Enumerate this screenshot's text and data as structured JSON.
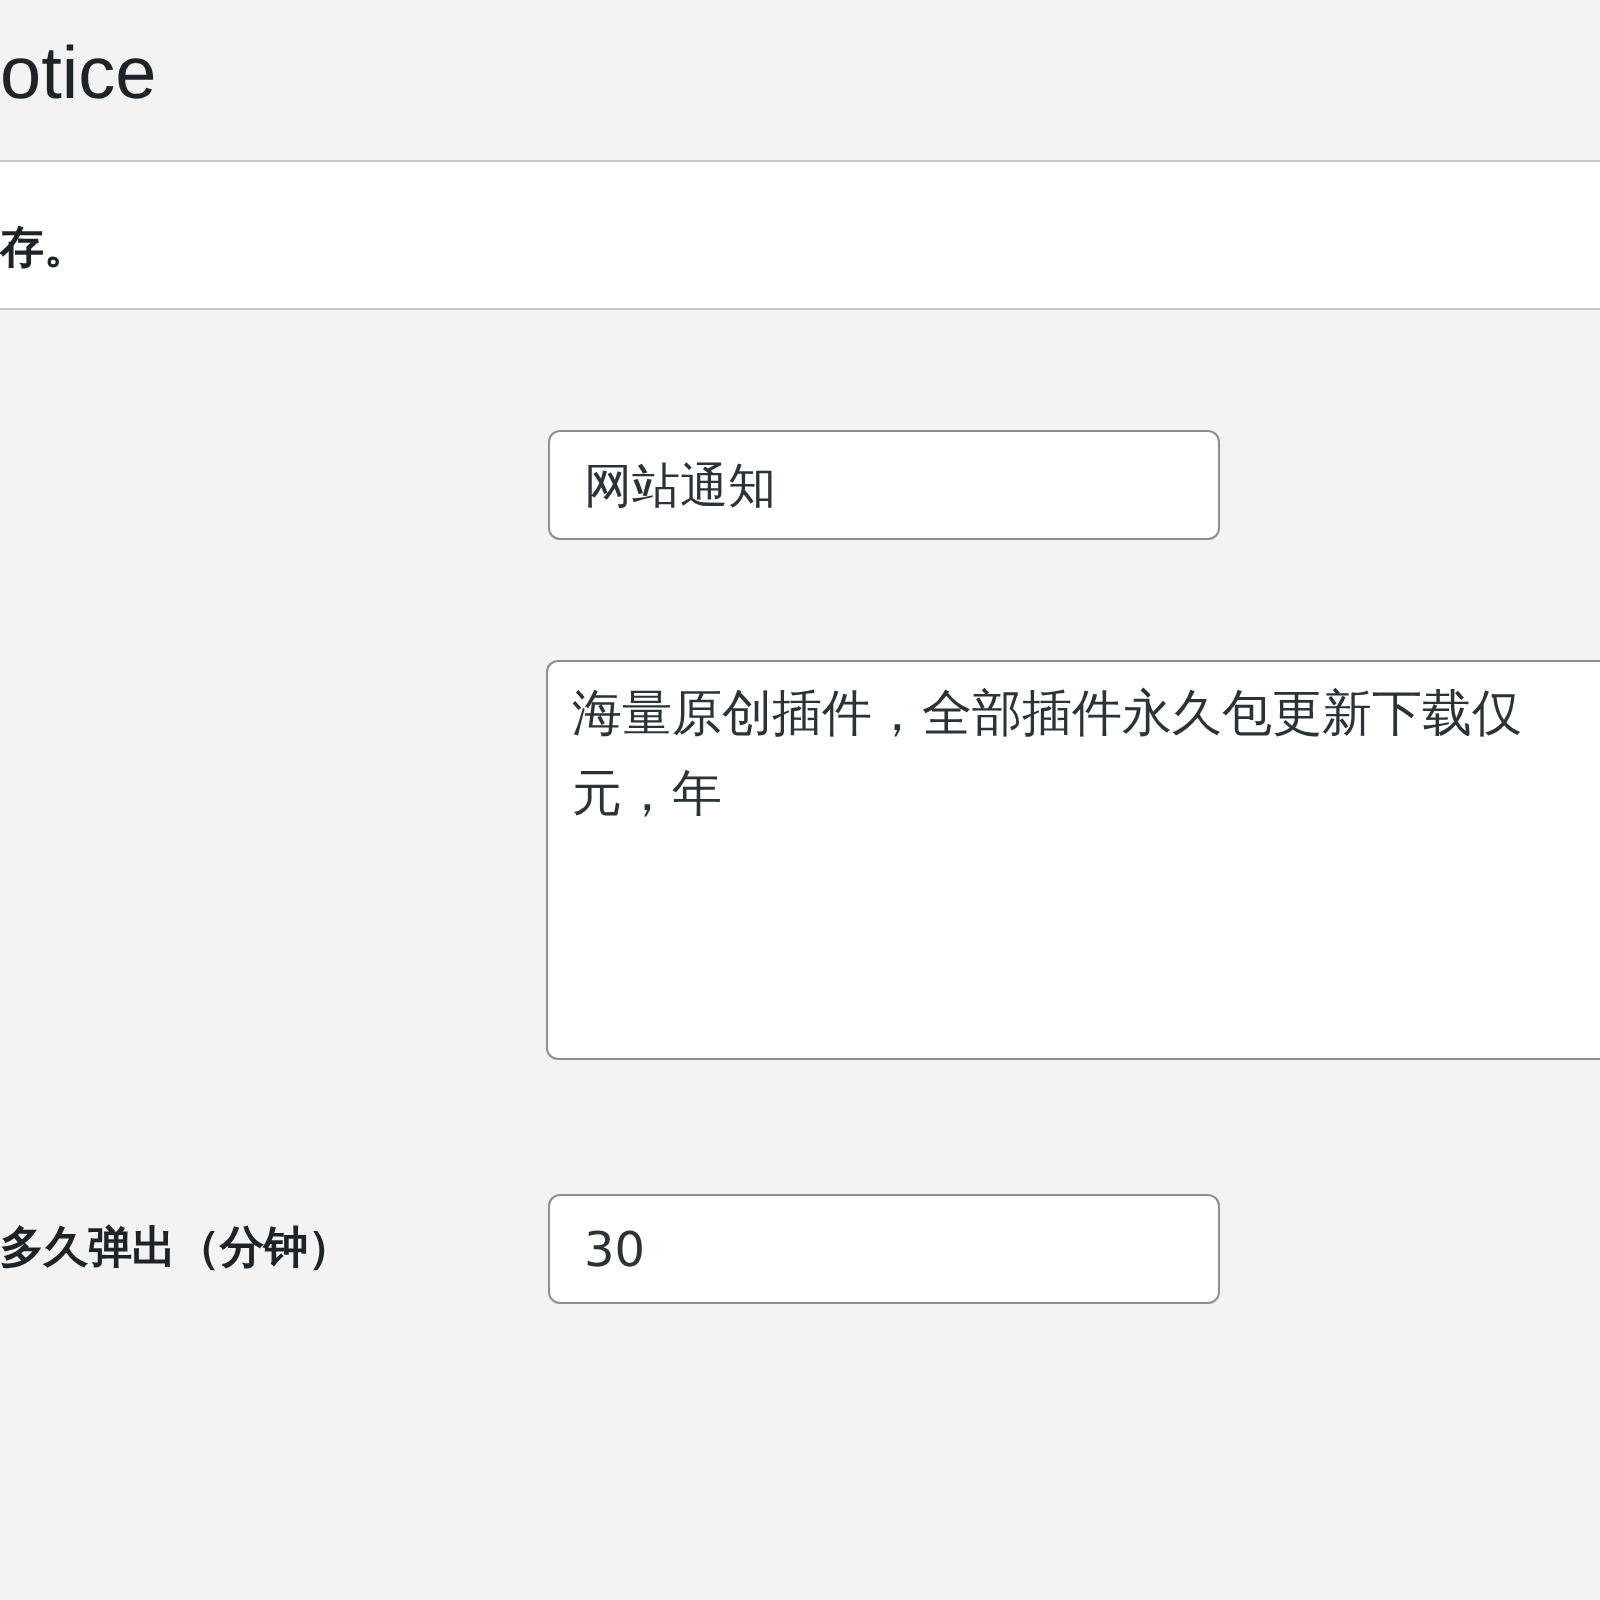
{
  "page": {
    "title": "otice"
  },
  "notice": {
    "message": "存。"
  },
  "fields": [
    {
      "kind": "text",
      "value": "网站通知"
    },
    {
      "kind": "textarea",
      "value_lines": [
        "海量原创插件，全部插件永久包更新下载仅",
        "元，年"
      ]
    },
    {
      "kind": "text",
      "label": "多久弹出（分钟）",
      "value": "30"
    }
  ]
}
